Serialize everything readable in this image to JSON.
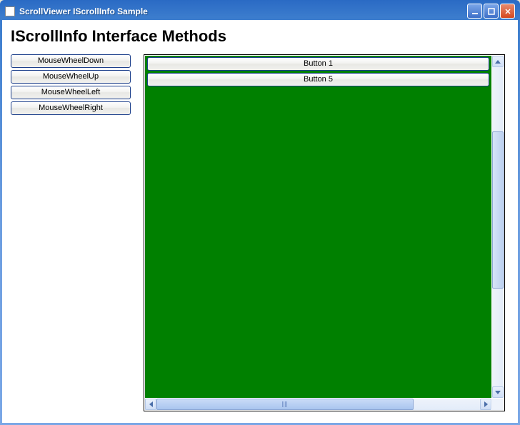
{
  "window": {
    "title": "ScrollViewer IScrollInfo Sample"
  },
  "heading": "IScrollInfo Interface Methods",
  "sidebar": {
    "buttons": [
      {
        "label": "MouseWheelDown"
      },
      {
        "label": "MouseWheelUp"
      },
      {
        "label": "MouseWheelLeft"
      },
      {
        "label": "MouseWheelRight"
      }
    ]
  },
  "viewport": {
    "background": "#008000",
    "buttons": [
      {
        "label": "Button 1"
      },
      {
        "label": "Button 5"
      }
    ]
  }
}
